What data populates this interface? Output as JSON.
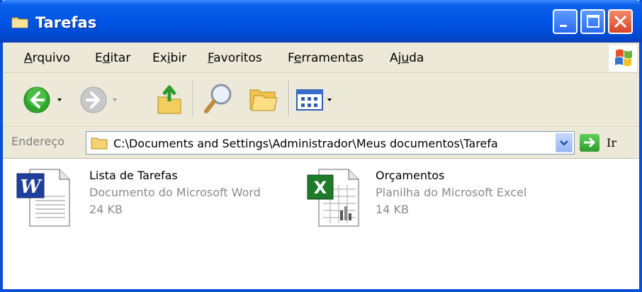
{
  "window": {
    "title": "Tarefas",
    "title_icon": "folder-icon",
    "controls": [
      "minimize-icon",
      "maximize-icon",
      "close-icon"
    ]
  },
  "menu": {
    "items": [
      {
        "label": "Arquivo",
        "accel": "A",
        "rest": "rquivo",
        "pre": ""
      },
      {
        "label": "Editar",
        "pre": "E",
        "accel": "d",
        "rest": "itar"
      },
      {
        "label": "Exibir",
        "pre": "Ex",
        "accel": "i",
        "rest": "bir"
      },
      {
        "label": "Favoritos",
        "pre": "",
        "accel": "F",
        "rest": "avoritos"
      },
      {
        "label": "Ferramentas",
        "pre": "F",
        "accel": "e",
        "rest": "rramentas"
      },
      {
        "label": "Ajuda",
        "pre": "Aj",
        "accel": "u",
        "rest": "da"
      }
    ]
  },
  "toolbar": {
    "buttons": [
      "back-icon",
      "forward-icon",
      "up-folder-icon",
      "search-icon",
      "folders-icon",
      "views-icon"
    ]
  },
  "address": {
    "label": "Endereço",
    "path": "C:\\Documents and Settings\\Administrador\\Meus documentos\\Tarefa",
    "go_label": "Ir"
  },
  "files": [
    {
      "name": "Lista de Tarefas",
      "type": "Documento do Microsoft Word",
      "size": "24 KB",
      "icon": "word-document-icon"
    },
    {
      "name": "Orçamentos",
      "type": "Planilha do Microsoft Excel",
      "size": "14 KB",
      "icon": "excel-spreadsheet-icon"
    }
  ],
  "colors": {
    "titlebar": "#0055e5",
    "chrome": "#ece9d8",
    "close_button": "#d8452a"
  }
}
